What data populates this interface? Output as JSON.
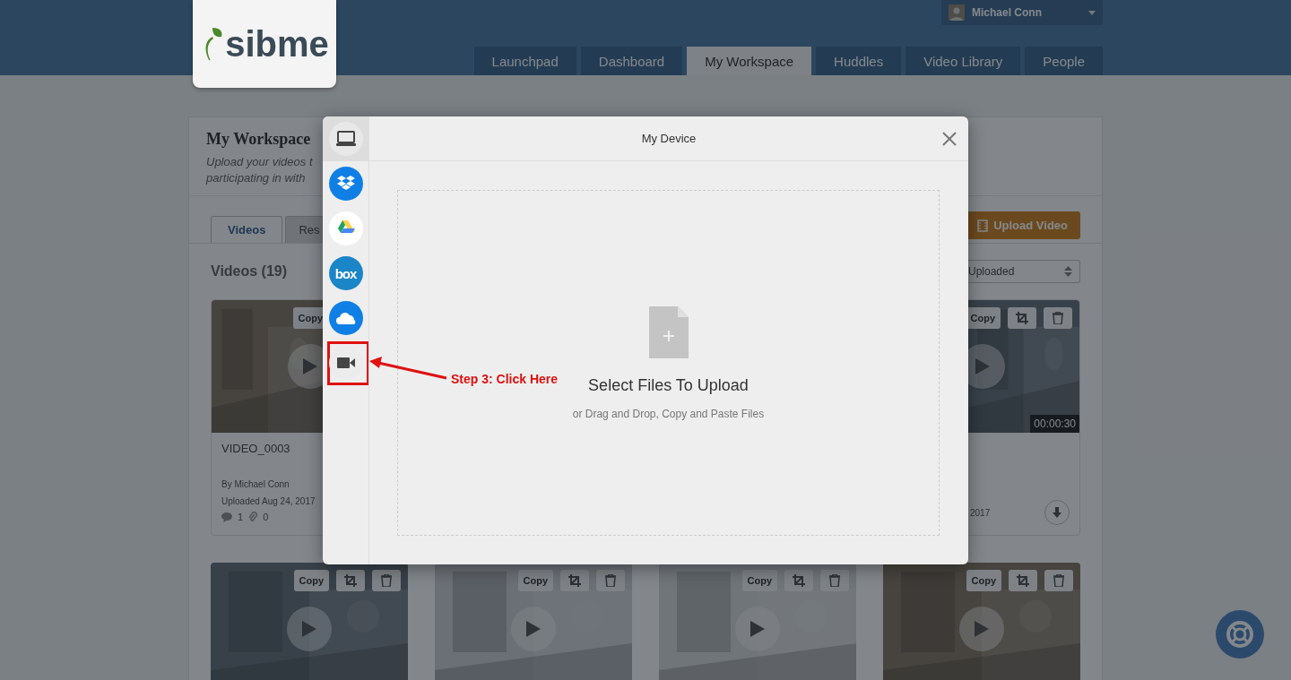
{
  "header": {
    "logo": "sibme",
    "user": {
      "name": "Michael Conn"
    },
    "nav": [
      {
        "label": "Launchpad",
        "selected": false
      },
      {
        "label": "Dashboard",
        "selected": false
      },
      {
        "label": "My Workspace",
        "selected": true
      },
      {
        "label": "Huddles",
        "selected": false
      },
      {
        "label": "Video Library",
        "selected": false
      },
      {
        "label": "People",
        "selected": false
      }
    ]
  },
  "workspace": {
    "title": "My Workspace",
    "subtitle_lines": [
      "Upload your videos t",
      "participating in with"
    ],
    "tabs": [
      {
        "label": "Videos",
        "selected": true
      },
      {
        "label": "Res",
        "selected": false
      }
    ],
    "upload_button": "Upload Video",
    "videos_heading": "Videos (19)",
    "sort": {
      "value": "Uploaded"
    },
    "cards_row_1": [
      {
        "tools": [
          {
            "kind": "copy",
            "label": "Copy"
          }
        ],
        "title": "VIDEO_0003",
        "author": "By Michael Conn",
        "date": "Uploaded Aug 24, 2017",
        "comments": "1",
        "attachments": "0"
      },
      {
        "tools": [
          {
            "kind": "copy",
            "label": "Copy"
          },
          {
            "kind": "crop"
          },
          {
            "kind": "delete"
          }
        ],
        "duration": "00:00:30",
        "date": "2017"
      }
    ],
    "cards_row_2": [
      {
        "tools": [
          {
            "kind": "copy",
            "label": "Copy"
          },
          {
            "kind": "crop"
          },
          {
            "kind": "delete"
          }
        ]
      },
      {
        "tools": [
          {
            "kind": "copy",
            "label": "Copy"
          },
          {
            "kind": "crop"
          },
          {
            "kind": "delete"
          }
        ]
      },
      {
        "tools": [
          {
            "kind": "copy",
            "label": "Copy"
          },
          {
            "kind": "crop"
          },
          {
            "kind": "delete"
          }
        ]
      },
      {
        "tools": [
          {
            "kind": "copy",
            "label": "Copy"
          },
          {
            "kind": "crop"
          },
          {
            "kind": "delete"
          }
        ]
      }
    ]
  },
  "modal": {
    "title": "My Device",
    "sources": [
      {
        "kind": "device",
        "selected": true
      },
      {
        "kind": "dropbox",
        "selected": false
      },
      {
        "kind": "drive",
        "selected": false
      },
      {
        "kind": "box",
        "label": "box",
        "selected": false
      },
      {
        "kind": "onedrive",
        "selected": false
      },
      {
        "kind": "camera",
        "selected": false
      }
    ],
    "dropzone": {
      "title": "Select Files To Upload",
      "hint": "or Drag and Drop, Copy and Paste Files"
    }
  },
  "annotation": {
    "label": "Step 3: Click Here"
  }
}
